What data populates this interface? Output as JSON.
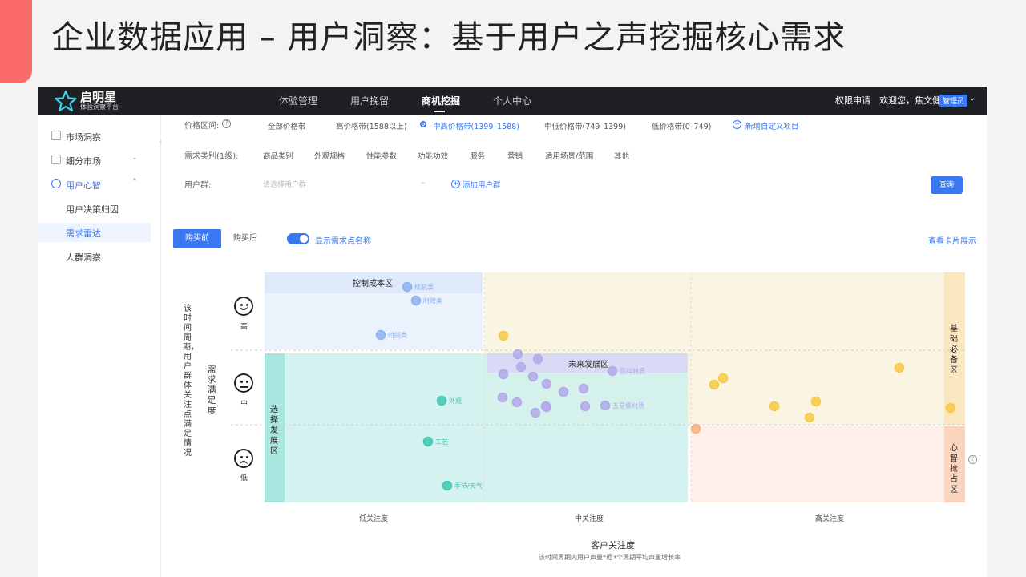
{
  "slide": {
    "title": "企业数据应用 – 用户洞察：基于用户之声挖掘核心需求",
    "accent_color": "#fb6b6b"
  },
  "app": {
    "logo_name": "启明星",
    "logo_sub": "体验洞察平台",
    "nav": [
      "体验管理",
      "用户挽留",
      "商机挖掘",
      "个人中心"
    ],
    "active_nav": "商机挖掘",
    "permission": "权限申请",
    "welcome": "欢迎您，焦文健",
    "role_badge": "管理员"
  },
  "sidebar": {
    "items": [
      {
        "label": "市场洞察",
        "icon": "chart-icon"
      },
      {
        "label": "细分市场",
        "icon": "grid-icon"
      },
      {
        "label": "用户心智",
        "icon": "bulb-icon"
      },
      {
        "label": "用户决策归因"
      },
      {
        "label": "需求雷达"
      },
      {
        "label": "人群洞察"
      }
    ]
  },
  "filters": {
    "price_label": "价格区间:",
    "price_options": [
      "全部价格带",
      "高价格带(1588以上)",
      "中高价格带(1399–1588)",
      "中低价格带(749–1399)",
      "低价格带(0–749)"
    ],
    "price_selected": "中高价格带(1399–1588)",
    "add_custom": "新增自定义项目",
    "category_label": "需求类别(1级):",
    "category_options": [
      "商品类别",
      "外观规格",
      "性能参数",
      "功能功效",
      "服务",
      "营销",
      "适用场景/范围",
      "其他"
    ],
    "user_group_label": "用户群:",
    "user_group_placeholder": "请选择用户群",
    "add_group": "添加用户群",
    "query": "查询"
  },
  "tabs": {
    "before": "购买前",
    "after": "购买后",
    "active": "购买前"
  },
  "toggle": {
    "label": "显示需求点名称",
    "on": true
  },
  "card_view": "查看卡片展示",
  "chart_data": {
    "type": "scatter",
    "x_axis": {
      "title": "客户关注度",
      "subtitle": "该时间周期内用户声量*近3个周期平均声量增长率",
      "ticks": [
        "低关注度",
        "中关注度",
        "高关注度"
      ]
    },
    "y_axis": {
      "title": "需求满足度",
      "side_note": "该时间周期，用户群体关注点满足情况",
      "ticks": [
        "高",
        "中",
        "低"
      ]
    },
    "zones": [
      "控制成本区",
      "未来发展区",
      "基础必备区",
      "选择发展区",
      "心智抢占区"
    ],
    "zone_colors": {
      "control": "#dde8f8",
      "future": "#f8f1d8",
      "basic": "#fbe7bf",
      "choose": "#ccf0ec",
      "mind": "#fde4d6"
    },
    "points": [
      {
        "zone": "控制成本区",
        "label": "续航类",
        "color": "#8bb4ee"
      },
      {
        "zone": "控制成本区",
        "label": "附赠类",
        "color": "#8bb4ee"
      },
      {
        "zone": "控制成本区",
        "label": "时间类",
        "color": "#8bb4ee"
      },
      {
        "zone": "选择发展区",
        "label": "外观",
        "color": "#3ec9b2"
      },
      {
        "zone": "选择发展区",
        "label": "工艺",
        "color": "#3ec9b2"
      },
      {
        "zone": "选择发展区",
        "label": "季节/天气",
        "color": "#3ec9b2"
      },
      {
        "zone": "未来发展区",
        "label": "",
        "color": "#b3a9ea"
      },
      {
        "zone": "未来发展区",
        "label": "",
        "color": "#b3a9ea"
      },
      {
        "zone": "未来发展区",
        "label": "",
        "color": "#b3a9ea"
      },
      {
        "zone": "未来发展区",
        "label": "",
        "color": "#b3a9ea"
      },
      {
        "zone": "未来发展区",
        "label": "",
        "color": "#b3a9ea"
      },
      {
        "zone": "未来发展区",
        "label": "面料材质",
        "color": "#b3a9ea"
      },
      {
        "zone": "未来发展区",
        "label": "",
        "color": "#b3a9ea"
      },
      {
        "zone": "未来发展区",
        "label": "",
        "color": "#b3a9ea"
      },
      {
        "zone": "未来发展区",
        "label": "",
        "color": "#b3a9ea"
      },
      {
        "zone": "未来发展区",
        "label": "",
        "color": "#b3a9ea"
      },
      {
        "zone": "未来发展区",
        "label": "",
        "color": "#b3a9ea"
      },
      {
        "zone": "未来发展区",
        "label": "",
        "color": "#b3a9ea"
      },
      {
        "zone": "未来发展区",
        "label": "",
        "color": "#b3a9ea"
      },
      {
        "zone": "未来发展区",
        "label": "",
        "color": "#b3a9ea"
      },
      {
        "zone": "未来发展区",
        "label": "",
        "color": "#b3a9ea"
      },
      {
        "zone": "未来发展区",
        "label": "五星级材质",
        "color": "#b3a9ea"
      },
      {
        "zone": "基础必备区",
        "label": "",
        "color": "#f6c945"
      },
      {
        "zone": "基础必备区",
        "label": "",
        "color": "#f6c945"
      },
      {
        "zone": "基础必备区",
        "label": "",
        "color": "#f6c945"
      },
      {
        "zone": "基础必备区",
        "label": "",
        "color": "#f6c945"
      },
      {
        "zone": "基础必备区",
        "label": "",
        "color": "#f6c945"
      },
      {
        "zone": "基础必备区",
        "label": "",
        "color": "#f6c945"
      },
      {
        "zone": "基础必备区",
        "label": "",
        "color": "#f6c945"
      },
      {
        "zone": "基础必备区",
        "label": "",
        "color": "#f6c945"
      },
      {
        "zone": "心智抢占区",
        "label": "",
        "color": "#f8b07e"
      }
    ]
  }
}
